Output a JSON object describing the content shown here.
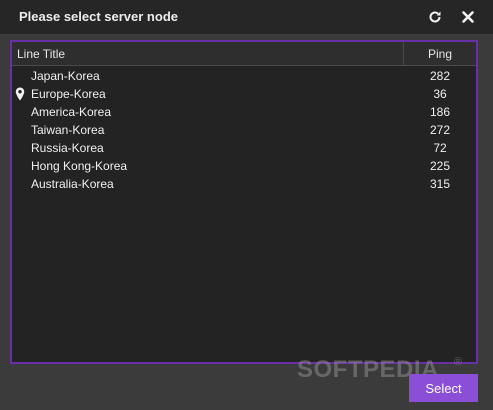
{
  "window": {
    "title": "Please select server node"
  },
  "toolbar": {
    "refresh_icon": "refresh-icon",
    "close_icon": "close-icon"
  },
  "table": {
    "columns": [
      "Line Title",
      "Ping"
    ],
    "rows": [
      {
        "name": "Japan-Korea",
        "ping": "282",
        "pinned": false
      },
      {
        "name": "Europe-Korea",
        "ping": "36",
        "pinned": true
      },
      {
        "name": "America-Korea",
        "ping": "186",
        "pinned": false
      },
      {
        "name": "Taiwan-Korea",
        "ping": "272",
        "pinned": false
      },
      {
        "name": "Russia-Korea",
        "ping": "72",
        "pinned": false
      },
      {
        "name": "Hong Kong-Korea",
        "ping": "225",
        "pinned": false
      },
      {
        "name": "Australia-Korea",
        "ping": "315",
        "pinned": false
      }
    ]
  },
  "footer": {
    "select_label": "Select"
  },
  "watermark": {
    "text": "SOFTPEDIA",
    "mark": "®"
  },
  "colors": {
    "accent": "#8a4fd6",
    "panel_border": "#6a2fa6",
    "titlebar": "#262626",
    "background": "#3b3b3b"
  }
}
